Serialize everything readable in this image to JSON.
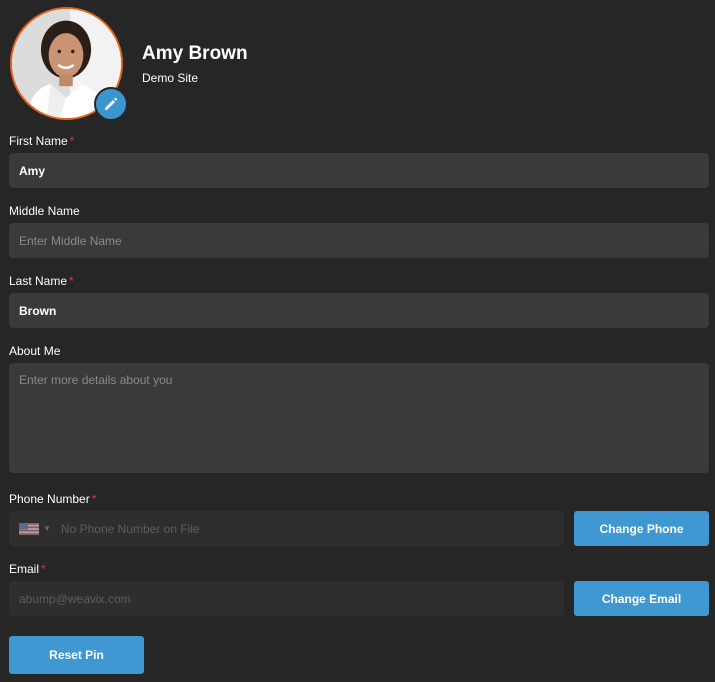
{
  "profile": {
    "name": "Amy Brown",
    "site": "Demo Site",
    "edit_icon": "pencil-icon"
  },
  "colors": {
    "accent": "#3f98d1",
    "avatar_ring": "#e0651f",
    "required": "#e23a3a",
    "background": "#262626",
    "field": "#3a3a3a"
  },
  "fields": {
    "first_name": {
      "label": "First Name",
      "required": "*",
      "value": "Amy"
    },
    "middle_name": {
      "label": "Middle Name",
      "placeholder": "Enter Middle Name"
    },
    "last_name": {
      "label": "Last Name",
      "required": "*",
      "value": "Brown"
    },
    "about_me": {
      "label": "About Me",
      "placeholder": "Enter more details about you"
    },
    "phone": {
      "label": "Phone Number",
      "required": "*",
      "placeholder": "No Phone Number on File",
      "country_icon": "us-flag-icon"
    },
    "email": {
      "label": "Email",
      "required": "*",
      "value": "abump@weavix.com"
    }
  },
  "buttons": {
    "change_phone": "Change Phone",
    "change_email": "Change Email",
    "reset_pin": "Reset Pin"
  }
}
